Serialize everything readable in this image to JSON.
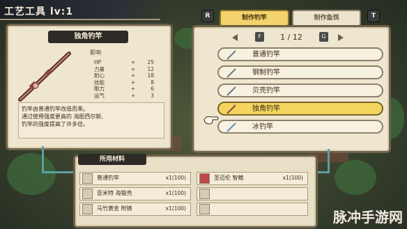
{
  "header": {
    "title": "工艺工具 lv:1"
  },
  "tabs": {
    "left_key": "R",
    "right_key": "T",
    "items": [
      {
        "label": "制作钓竿",
        "active": true
      },
      {
        "label": "制作鱼饵",
        "active": false
      }
    ]
  },
  "detail": {
    "item_name": "独角钓竿",
    "stats_title": "影响",
    "stats": [
      {
        "name": "HP",
        "sign": "+",
        "value": "25"
      },
      {
        "name": "力量",
        "sign": "+",
        "value": "12"
      },
      {
        "name": "耐心",
        "sign": "+",
        "value": "18"
      },
      {
        "name": "技能",
        "sign": "+",
        "value": "8"
      },
      {
        "name": "眼力",
        "sign": "+",
        "value": "6"
      },
      {
        "name": "运气",
        "sign": "+",
        "value": "3"
      }
    ],
    "description": [
      "钓竿由普通钓竿改造而来。",
      "通过使用强度更高的 海胆西尔斯,",
      "钓竿的强度提高了许多倍。"
    ]
  },
  "pager": {
    "left_key": "F",
    "right_key": "G",
    "text": "1 / 12"
  },
  "rod_list": [
    {
      "label": "普通钓竿",
      "selected": false
    },
    {
      "label": "钢制钓竿",
      "selected": false
    },
    {
      "label": "贝壳钓竿",
      "selected": false
    },
    {
      "label": "独角钓竿",
      "selected": true
    },
    {
      "label": "冰钓竿",
      "selected": false
    }
  ],
  "materials": {
    "title": "所用材料",
    "left": [
      {
        "name": "普通钓竿",
        "qty": "x1(100)"
      },
      {
        "name": "亚米特 海猫壳",
        "qty": "x1(100)"
      },
      {
        "name": "马竹黄金 附铸",
        "qty": "x1(100)"
      }
    ],
    "right": [
      {
        "name": "圣迈伦 智鳍",
        "qty": "x1(100)"
      },
      {
        "name": "",
        "qty": ""
      },
      {
        "name": "",
        "qty": ""
      }
    ]
  },
  "watermark": "脉冲手游网",
  "colors": {
    "selected": "#f3d45e",
    "panel": "#efe6d0",
    "border": "#6e6049"
  }
}
